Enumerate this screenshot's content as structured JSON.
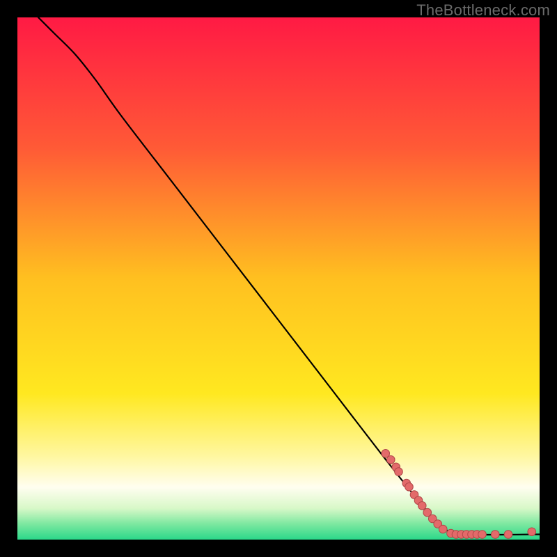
{
  "watermark": "TheBottleneck.com",
  "chart_data": {
    "type": "line",
    "title": "",
    "xlabel": "",
    "ylabel": "",
    "xlim": [
      0,
      100
    ],
    "ylim": [
      0,
      100
    ],
    "grid": false,
    "legend": false,
    "gradient_stops": [
      {
        "offset": 0.0,
        "color": "#ff1a44"
      },
      {
        "offset": 0.25,
        "color": "#ff5a36"
      },
      {
        "offset": 0.5,
        "color": "#ffc020"
      },
      {
        "offset": 0.72,
        "color": "#ffe820"
      },
      {
        "offset": 0.84,
        "color": "#fff7a0"
      },
      {
        "offset": 0.9,
        "color": "#fffef0"
      },
      {
        "offset": 0.94,
        "color": "#d8f8c8"
      },
      {
        "offset": 0.97,
        "color": "#7de8a0"
      },
      {
        "offset": 1.0,
        "color": "#2bd88a"
      }
    ],
    "curve": [
      {
        "x": 4,
        "y": 100
      },
      {
        "x": 7,
        "y": 97
      },
      {
        "x": 11,
        "y": 93
      },
      {
        "x": 15,
        "y": 88
      },
      {
        "x": 20,
        "y": 81
      },
      {
        "x": 30,
        "y": 68
      },
      {
        "x": 40,
        "y": 55
      },
      {
        "x": 50,
        "y": 42
      },
      {
        "x": 60,
        "y": 29
      },
      {
        "x": 70,
        "y": 16
      },
      {
        "x": 78,
        "y": 6
      },
      {
        "x": 82,
        "y": 2
      },
      {
        "x": 85,
        "y": 1
      },
      {
        "x": 100,
        "y": 1
      }
    ],
    "markers": [
      {
        "x": 70.5,
        "y": 16.5
      },
      {
        "x": 71.5,
        "y": 15.3
      },
      {
        "x": 72.5,
        "y": 13.9
      },
      {
        "x": 73.0,
        "y": 13.0
      },
      {
        "x": 74.5,
        "y": 10.8
      },
      {
        "x": 75.0,
        "y": 10.1
      },
      {
        "x": 76.0,
        "y": 8.6
      },
      {
        "x": 76.8,
        "y": 7.5
      },
      {
        "x": 77.5,
        "y": 6.5
      },
      {
        "x": 78.5,
        "y": 5.2
      },
      {
        "x": 79.5,
        "y": 4.0
      },
      {
        "x": 80.5,
        "y": 3.0
      },
      {
        "x": 81.5,
        "y": 2.0
      },
      {
        "x": 83.0,
        "y": 1.2
      },
      {
        "x": 84.0,
        "y": 1.0
      },
      {
        "x": 85.0,
        "y": 1.0
      },
      {
        "x": 86.0,
        "y": 1.0
      },
      {
        "x": 87.0,
        "y": 1.0
      },
      {
        "x": 88.0,
        "y": 1.0
      },
      {
        "x": 89.0,
        "y": 1.0
      },
      {
        "x": 91.5,
        "y": 1.0
      },
      {
        "x": 94.0,
        "y": 1.0
      },
      {
        "x": 98.5,
        "y": 1.5
      }
    ],
    "marker_style": {
      "fill": "#e36a6a",
      "stroke": "#b04848",
      "r": 5.8
    },
    "line_style": {
      "stroke": "#000000",
      "width": 2.2
    }
  }
}
